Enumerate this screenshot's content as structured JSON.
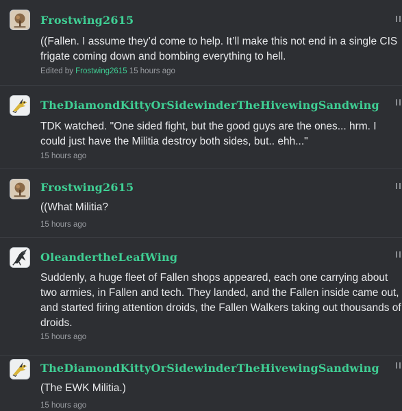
{
  "posts": [
    {
      "username": "Frostwing2615",
      "avatar_icon": "tree-avatar-icon",
      "lines": [
        "((Fallen. I assume they’d come to help. It’ll make this not end in a single CIS",
        "frigate coming down and bombing everything to hell."
      ],
      "edited_prefix": "Edited by",
      "edited_by": "Frostwing2615",
      "timestamp": "15 hours ago"
    },
    {
      "username": "TheDiamondKittyOrSidewinderTheHivewingSandwing",
      "avatar_icon": "dragon-avatar-icon",
      "lines": [
        "TDK watched. \"One sided fight, but the good guys are the ones... hrm. I",
        "could just have the Militia destroy both sides, but.. ehh...\""
      ],
      "timestamp": "15 hours ago"
    },
    {
      "username": "Frostwing2615",
      "avatar_icon": "tree-avatar-icon",
      "lines": [
        "((What Militia?"
      ],
      "timestamp": "15 hours ago"
    },
    {
      "username": "OleandertheLeafWing",
      "avatar_icon": "leafwing-avatar-icon",
      "lines": [
        "Suddenly, a huge fleet of Fallen shops appeared, each one carrying about",
        "two armies, in Fallen and tech. They landed, and the Fallen inside came out,",
        "and started firing attention droids, the Fallen Walkers taking out thousands of",
        "droids."
      ],
      "timestamp": "15 hours ago"
    },
    {
      "username": "TheDiamondKittyOrSidewinderTheHivewingSandwing",
      "avatar_icon": "dragon-avatar-icon",
      "lines": [
        "(The EWK Militia.)"
      ],
      "timestamp": "15 hours ago"
    }
  ],
  "colors": {
    "background": "#2d2f33",
    "username": "#3fcf94",
    "body_text": "#e7e8ea",
    "meta_text": "#9a9da2",
    "divider": "#3b3e43"
  }
}
